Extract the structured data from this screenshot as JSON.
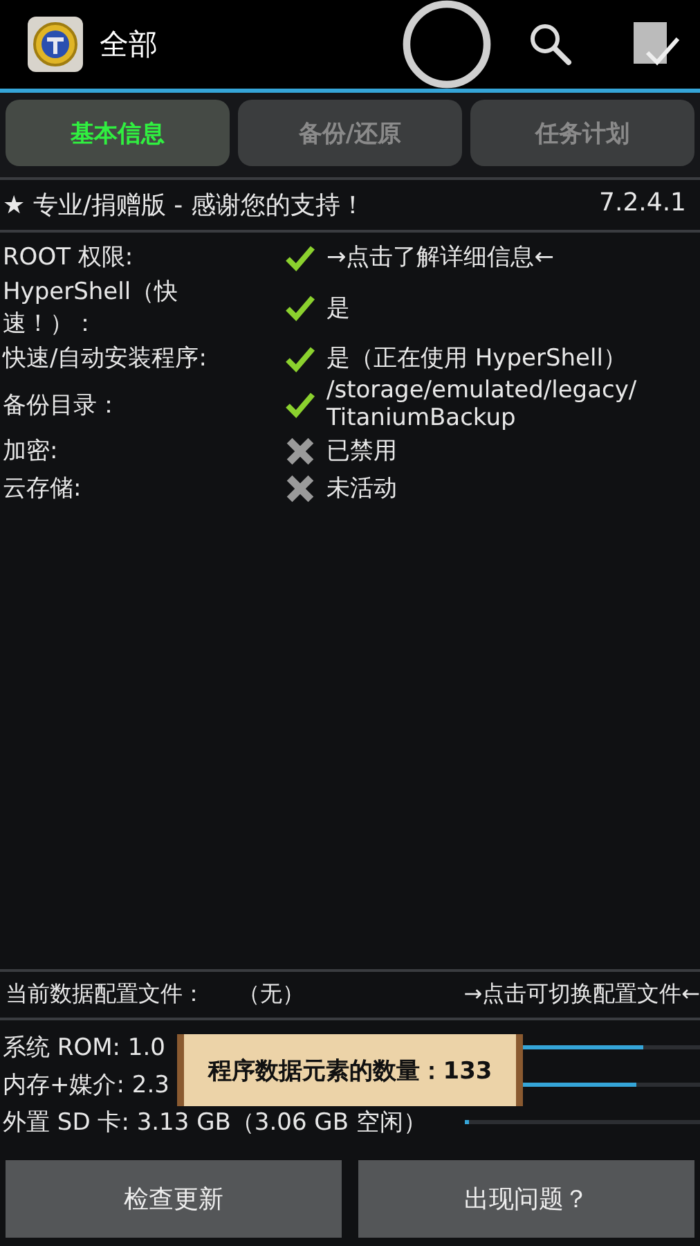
{
  "app_bar": {
    "title": "全部"
  },
  "tabs": [
    {
      "label": "基本信息",
      "selected": true
    },
    {
      "label": "备份/还原",
      "selected": false
    },
    {
      "label": "任务计划",
      "selected": false
    }
  ],
  "banner": {
    "text": "★ 专业/捐赠版 - 感谢您的支持！",
    "version": "7.2.4.1"
  },
  "info_rows": [
    {
      "label": "ROOT 权限:",
      "ok": true,
      "value": "→点击了解详细信息←"
    },
    {
      "label": "HyperShell（快速！）：",
      "ok": true,
      "value": "是"
    },
    {
      "label": "快速/自动安装程序:",
      "ok": true,
      "value": "是（正在使用 HyperShell）"
    },
    {
      "label": "备份目录：",
      "ok": true,
      "value": "/storage/emulated/legacy/ TitaniumBackup"
    },
    {
      "label": "加密:",
      "ok": false,
      "value": "已禁用"
    },
    {
      "label": "云存储:",
      "ok": false,
      "value": "未活动"
    }
  ],
  "profile": {
    "label": "当前数据配置文件：",
    "value": "（无）",
    "hint": "→点击可切换配置文件←"
  },
  "storage": [
    {
      "text": "系统 ROM: 1.0",
      "level": 0.76
    },
    {
      "text": "内存+媒介: 2.3",
      "level": 0.73
    },
    {
      "text": "外置 SD 卡: 3.13 GB（3.06 GB 空闲）",
      "level": 0.02
    }
  ],
  "toast": {
    "text": "程序数据元素的数量：133"
  },
  "buttons": [
    "检查更新",
    "出现问题？"
  ]
}
